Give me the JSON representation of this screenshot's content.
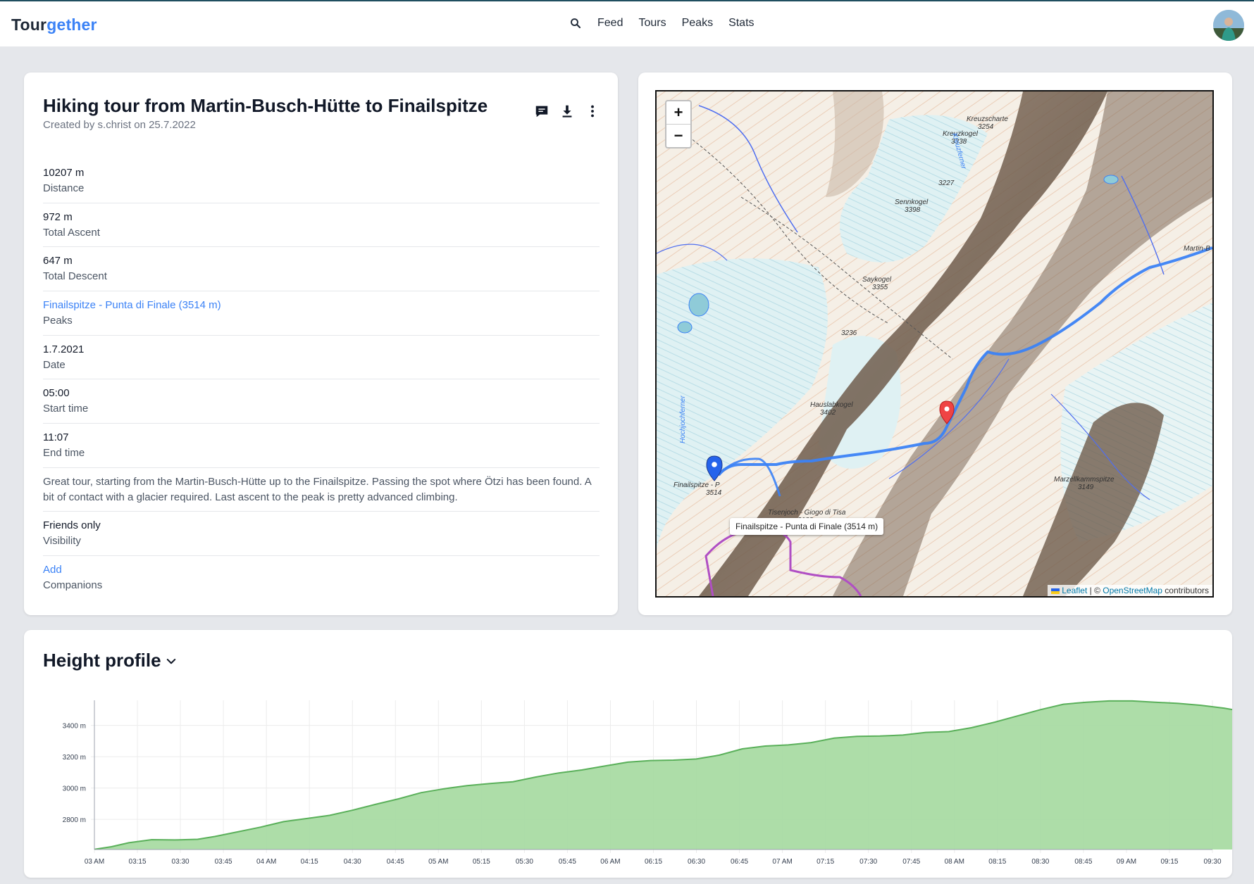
{
  "app": {
    "logo_part1": "Tour",
    "logo_part2": "gether"
  },
  "nav": {
    "items": [
      "Feed",
      "Tours",
      "Peaks",
      "Stats"
    ],
    "search_icon": "search-icon"
  },
  "tour": {
    "title": "Hiking tour from Martin-Busch-Hütte to Finailspitze",
    "created_by_prefix": "Created by ",
    "author": "s.christ",
    "created_on_prefix": " on ",
    "created_date": "25.7.2022",
    "actions": [
      "comment-icon",
      "download-icon",
      "more-vertical-icon"
    ],
    "fields": [
      {
        "value": "10207 m",
        "label": "Distance"
      },
      {
        "value": "972 m",
        "label": "Total Ascent"
      },
      {
        "value": "647 m",
        "label": "Total Descent"
      },
      {
        "value": "Finailspitze - Punta di Finale (3514 m)",
        "label": "Peaks",
        "link": true
      },
      {
        "value": "1.7.2021",
        "label": "Date"
      },
      {
        "value": "05:00",
        "label": "Start time"
      },
      {
        "value": "11:07",
        "label": "End time"
      }
    ],
    "description": "Great tour, starting from the Martin-Busch-Hütte up to the Finailspitze. Passing the spot where Ötzi has been found. A bit of contact with a glacier required. Last ascent to the peak is pretty advanced climbing.",
    "visibility": {
      "value": "Friends only",
      "label": "Visibility"
    },
    "companions": {
      "value": "Add",
      "label": "Companions"
    }
  },
  "map": {
    "zoom_in": "+",
    "zoom_out": "−",
    "tooltip": "Finailspitze - Punta di Finale (3514 m)",
    "attribution_leaflet": "Leaflet",
    "attribution_sep": " | © ",
    "attribution_osm": "OpenStreetMap",
    "attribution_tail": " contributors",
    "labels": [
      "Kreuzscharte",
      "3254",
      "Kreuzkogel",
      "3338",
      "3227",
      "Sennkogel",
      "3398",
      "Saykogel",
      "3355",
      "3236",
      "Hauslabkogel",
      "3402",
      "Finailspitze - P",
      "3514",
      "Tisenjoch - Giogo di Tisa",
      "3188",
      "Marzellkammspitze",
      "3149",
      "Martin-B",
      "Kreuzferner",
      "Hochjochferner"
    ]
  },
  "profile": {
    "title": "Height profile",
    "toggle_icon": "chevron-down-icon"
  },
  "chart_data": {
    "type": "area",
    "title": "Height profile",
    "xlabel": "",
    "ylabel": "",
    "x_ticks": [
      "03 AM",
      "03:15",
      "03:30",
      "03:45",
      "04 AM",
      "04:15",
      "04:30",
      "04:45",
      "05 AM",
      "05:15",
      "05:30",
      "05:45",
      "06 AM",
      "06:15",
      "06:30",
      "06:45",
      "07 AM",
      "07:15",
      "07:30",
      "07:45",
      "08 AM",
      "08:15",
      "08:30",
      "08:45",
      "09 AM",
      "09:15",
      "09:30"
    ],
    "y_ticks": [
      "2800 m",
      "3000 m",
      "3200 m",
      "3400 m"
    ],
    "y_tick_values": [
      2800,
      3000,
      3200,
      3400
    ],
    "ylim": [
      2607,
      3560
    ],
    "x_minutes": [
      0,
      6,
      12,
      20,
      28,
      36,
      42,
      50,
      58,
      66,
      74,
      82,
      90,
      98,
      106,
      114,
      122,
      130,
      138,
      146,
      154,
      162,
      170,
      178,
      186,
      194,
      202,
      210,
      218,
      226,
      234,
      242,
      250,
      258,
      266,
      274,
      282,
      290,
      298,
      306,
      314,
      322,
      330,
      338,
      346,
      354,
      362,
      370,
      378,
      386,
      394,
      402,
      410,
      418,
      426,
      434,
      442,
      450,
      458,
      466,
      474,
      482,
      490,
      496
    ],
    "heights": [
      2608,
      2625,
      2650,
      2670,
      2668,
      2672,
      2690,
      2720,
      2750,
      2785,
      2805,
      2825,
      2858,
      2895,
      2930,
      2970,
      2995,
      3015,
      3028,
      3040,
      3070,
      3096,
      3115,
      3140,
      3165,
      3175,
      3178,
      3185,
      3210,
      3250,
      3268,
      3275,
      3290,
      3318,
      3330,
      3332,
      3338,
      3355,
      3360,
      3385,
      3420,
      3460,
      3500,
      3535,
      3548,
      3556,
      3556,
      3548,
      3540,
      3528,
      3510,
      3485,
      3445,
      3405,
      3385,
      3365,
      3352,
      3330,
      3310,
      3270,
      3196,
      3150,
      3088,
      3036,
      2990,
      2970
    ],
    "color": "#a9dba3",
    "line_color": "#5ab05a"
  }
}
